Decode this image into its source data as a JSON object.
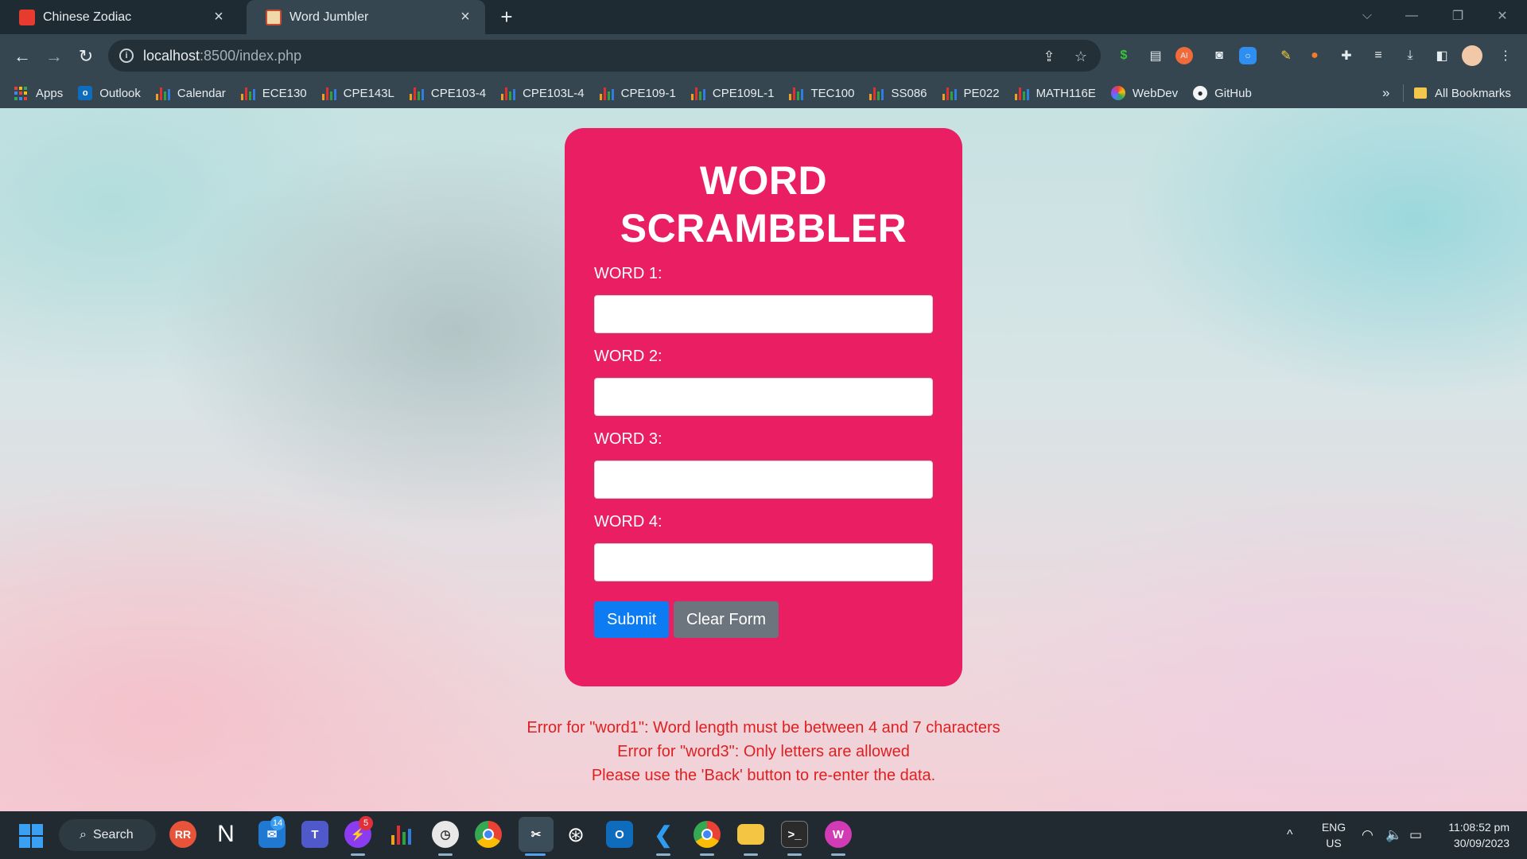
{
  "browser": {
    "tabs": [
      {
        "title": "Chinese Zodiac",
        "active": false
      },
      {
        "title": "Word Jumbler",
        "active": true
      }
    ],
    "new_tab_label": "+",
    "url_host": "localhost",
    "url_rest": ":8500/index.php"
  },
  "bookmarks": {
    "items": [
      {
        "label": "Apps",
        "icon": "apps-grid-icon"
      },
      {
        "label": "Outlook",
        "icon": "outlook-icon"
      },
      {
        "label": "Calendar",
        "icon": "bar-chart-icon"
      },
      {
        "label": "ECE130",
        "icon": "bar-chart-icon"
      },
      {
        "label": "CPE143L",
        "icon": "bar-chart-icon"
      },
      {
        "label": "CPE103-4",
        "icon": "bar-chart-icon"
      },
      {
        "label": "CPE103L-4",
        "icon": "bar-chart-icon"
      },
      {
        "label": "CPE109-1",
        "icon": "bar-chart-icon"
      },
      {
        "label": "CPE109L-1",
        "icon": "bar-chart-icon"
      },
      {
        "label": "TEC100",
        "icon": "bar-chart-icon"
      },
      {
        "label": "SS086",
        "icon": "bar-chart-icon"
      },
      {
        "label": "PE022",
        "icon": "bar-chart-icon"
      },
      {
        "label": "MATH116E",
        "icon": "bar-chart-icon"
      },
      {
        "label": "WebDev",
        "icon": "swirl-icon"
      },
      {
        "label": "GitHub",
        "icon": "github-icon"
      }
    ],
    "overflow_label": "»",
    "all_bookmarks_label": "All Bookmarks"
  },
  "form": {
    "title_line1": "WORD",
    "title_line2": "SCRAMBBLER",
    "fields": [
      {
        "label": "WORD 1:",
        "value": ""
      },
      {
        "label": "WORD 2:",
        "value": ""
      },
      {
        "label": "WORD 3:",
        "value": ""
      },
      {
        "label": "WORD 4:",
        "value": ""
      }
    ],
    "submit_label": "Submit",
    "clear_label": "Clear Form"
  },
  "errors": [
    "Error for \"word1\": Word length must be between 4 and 7 characters",
    "Error for \"word3\": Only letters are allowed",
    "Please use the 'Back' button to re-enter the data."
  ],
  "taskbar": {
    "search_label": "Search",
    "avatar_initials": "RR",
    "badge_mail": "14",
    "badge_messenger": "5",
    "lang_line1": "ENG",
    "lang_line2": "US",
    "time": "11:08:52 pm",
    "date": "30/09/2023"
  },
  "colors": {
    "card": "#e91e63",
    "submit": "#0d7cf2",
    "clear": "#6c757d",
    "error_text": "#e02020"
  }
}
